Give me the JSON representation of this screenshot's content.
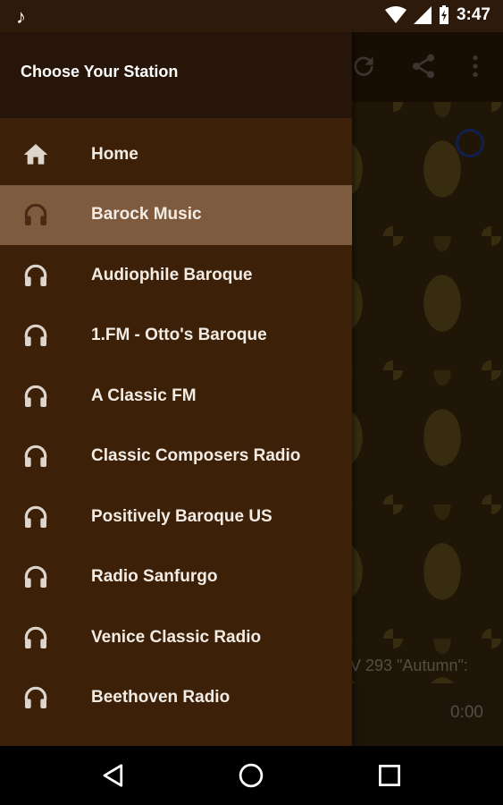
{
  "status_bar": {
    "time": "3:47",
    "icons": [
      "music-note-icon",
      "wifi-icon",
      "signal-icon",
      "battery-charging-icon"
    ]
  },
  "background_app": {
    "toolbar_icons": [
      "refresh-icon",
      "share-icon",
      "more-vert-icon"
    ],
    "track_text": "V 293 \"Autumn\":",
    "time_text": "0:00"
  },
  "drawer": {
    "title": "Choose Your Station",
    "items": [
      {
        "label": "Home",
        "icon": "home-icon",
        "selected": false
      },
      {
        "label": "Barock Music",
        "icon": "headphones-icon",
        "selected": true
      },
      {
        "label": "Audiophile Baroque",
        "icon": "headphones-icon",
        "selected": false
      },
      {
        "label": "1.FM - Otto's Baroque",
        "icon": "headphones-icon",
        "selected": false
      },
      {
        "label": "A Classic FM",
        "icon": "headphones-icon",
        "selected": false
      },
      {
        "label": "Classic Composers Radio",
        "icon": "headphones-icon",
        "selected": false
      },
      {
        "label": "Positively Baroque US",
        "icon": "headphones-icon",
        "selected": false
      },
      {
        "label": "Radio Sanfurgo",
        "icon": "headphones-icon",
        "selected": false
      },
      {
        "label": "Venice Classic Radio",
        "icon": "headphones-icon",
        "selected": false
      },
      {
        "label": "Beethoven Radio",
        "icon": "headphones-icon",
        "selected": false
      }
    ]
  },
  "nav_bar": {
    "buttons": [
      "back-icon",
      "home-circle-icon",
      "recents-icon"
    ]
  },
  "colors": {
    "drawer_bg": "#3c2008",
    "drawer_header_bg": "#261508",
    "selected_item_bg": "#7e5b3e",
    "status_bar_bg": "#2d1a0a"
  }
}
